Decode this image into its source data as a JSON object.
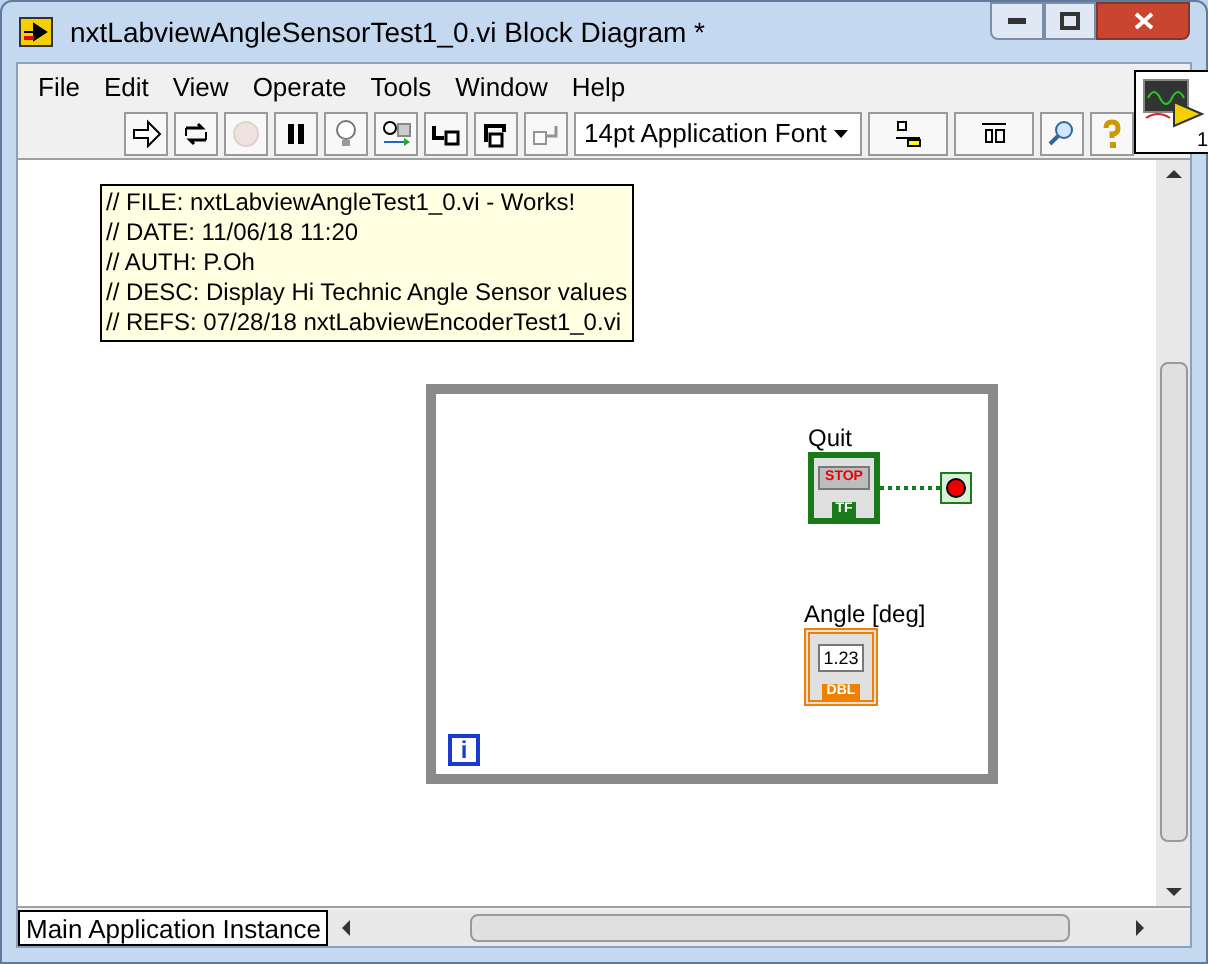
{
  "window": {
    "title": "nxtLabviewAngleSensorTest1_0.vi Block Diagram *"
  },
  "menu": [
    "File",
    "Edit",
    "View",
    "Operate",
    "Tools",
    "Window",
    "Help"
  ],
  "toolbar": [
    {
      "kind": "run",
      "disabled": false
    },
    {
      "kind": "run-continuous",
      "disabled": false
    },
    {
      "kind": "abort",
      "disabled": true
    },
    {
      "kind": "pause",
      "disabled": false
    },
    {
      "kind": "highlight",
      "disabled": false
    },
    {
      "kind": "retain",
      "disabled": false
    },
    {
      "kind": "step-into",
      "disabled": false
    },
    {
      "kind": "step-over",
      "disabled": false
    },
    {
      "kind": "step-out",
      "disabled": true
    },
    {
      "kind": "font",
      "label": "14pt Application Font",
      "disabled": false
    },
    {
      "kind": "align",
      "disabled": false
    },
    {
      "kind": "distribute",
      "disabled": false
    },
    {
      "kind": "search",
      "disabled": false
    },
    {
      "kind": "help",
      "disabled": false
    }
  ],
  "connector_pane": {
    "label": "1"
  },
  "comment": [
    "// FILE: nxtLabviewAngleTest1_0.vi - Works!",
    "// DATE: 11/06/18 11:20",
    "// AUTH: P.Oh",
    "// DESC: Display Hi Technic Angle Sensor values",
    "// REFS: 07/28/18 nxtLabviewEncoderTest1_0.vi"
  ],
  "loop": {
    "iteration_label": "i",
    "terminals": [
      {
        "kind": "boolean",
        "label": "Quit",
        "button_text": "STOP",
        "type": "TF"
      },
      {
        "kind": "numeric",
        "label": "Angle [deg]",
        "value": "1.23",
        "type": "DBL"
      }
    ]
  },
  "status_bar": {
    "context": "Main Application Instance"
  }
}
